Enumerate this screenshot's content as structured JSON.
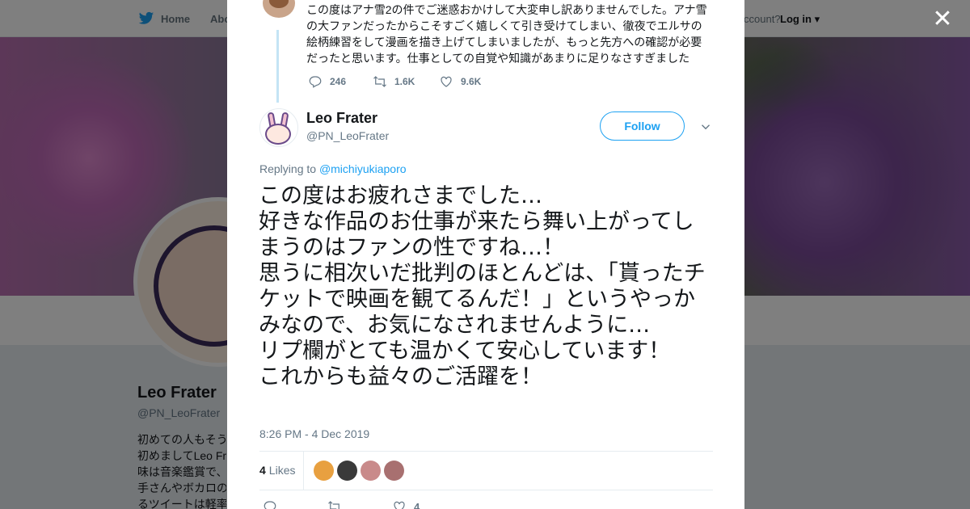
{
  "background_page": {
    "nav": {
      "home_label": "Home",
      "about_label": "Abo",
      "account_text": "ccount?",
      "login_label": "Log in"
    },
    "profile_name": "Leo Frater",
    "profile_handle": "@PN_LeoFrater",
    "bio_lines": [
      "初めての人もそう",
      "初めましてLeo Fr",
      "味は音楽鑑賞で、",
      "手さんやボカロの",
      "るツイートは軽率"
    ]
  },
  "close_icon_glyph": "✕",
  "parent_tweet": {
    "text": "この度はアナ雪2の件でご迷惑おかけして大変申し訳ありませんでした。アナ雪の大ファンだったからこそすごく嬉しくて引き受けてしまい、徹夜でエルサの絵柄練習をして漫画を描き上げてしまいましたが、もっと先方への確認が必要だったと思います。仕事としての自覚や知識があまりに足りなさすぎました",
    "replies": "246",
    "retweets": "1.6K",
    "likes": "9.6K"
  },
  "tweet": {
    "author_name": "Leo Frater",
    "author_handle": "@PN_LeoFrater",
    "follow_label": "Follow",
    "replying_prefix": "Replying to",
    "replying_to": "@michiyukiaporo",
    "text": "この度はお疲れさまでした…\n好きな作品のお仕事が来たら舞い上がってしまうのはファンの性ですね…！\n思うに相次いだ批判のほとんどは、「貰ったチケットで映画を観てるんだ！」というやっかみなので、お気になされませんように…\nリプ欄がとても温かくて安心しています！\nこれからも益々のご活躍を！",
    "timestamp": "8:26 PM - 4 Dec 2019",
    "likes_count": "4",
    "likes_label": "Likes",
    "bottom_likes": "4"
  },
  "colors": {
    "accent": "#1da1f2",
    "thread_line": "#c4e4f5",
    "muted_text": "#657786",
    "liker_avatars": [
      "#e8a040",
      "#3a3a3a",
      "#c98a8a",
      "#a87070"
    ]
  }
}
